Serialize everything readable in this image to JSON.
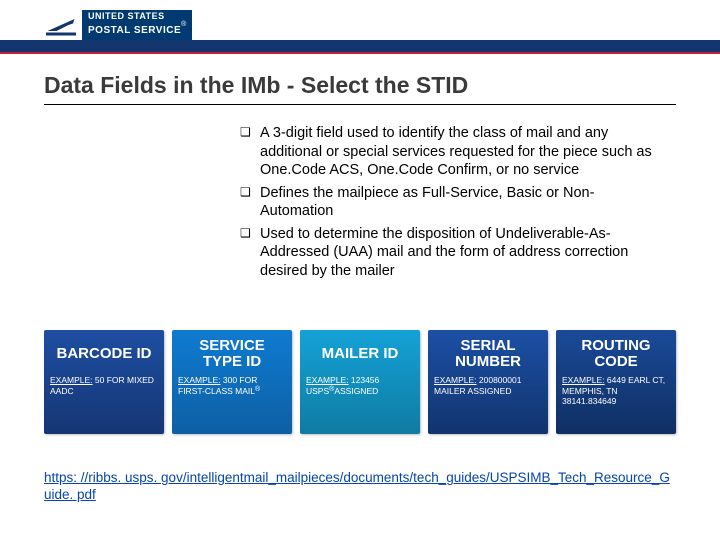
{
  "logo": {
    "line1": "UNITED STATES",
    "line2": "POSTAL SERVICE",
    "reg": "®"
  },
  "title": "Data Fields in the IMb - Select the STID",
  "bullets": [
    "A 3-digit field used to identify the class of mail and any additional or special services requested for the piece such as One.Code ACS, One.Code Confirm, or no service",
    "Defines the mailpiece as Full-Service, Basic or Non-Automation",
    "Used to determine the disposition of Undeliverable-As-Addressed (UAA) mail and the form of address correction desired by the mailer"
  ],
  "cards": [
    {
      "title": "BARCODE ID",
      "ex_label": "EXAMPLE:",
      "ex_text": " 50 FOR MIXED AADC",
      "color": "c-blue1"
    },
    {
      "title": "SERVICE TYPE ID",
      "ex_label": "EXAMPLE:",
      "ex_text": " 300 FOR FIRST-CLASS MAIL",
      "reg": "®",
      "color": "c-blue2"
    },
    {
      "title": "MAILER ID",
      "ex_label": "EXAMPLE:",
      "ex_text": " 123456",
      "reg_after": "®",
      "extra": "USPS",
      "extra2": "ASSIGNED",
      "color": "c-cyan"
    },
    {
      "title": "SERIAL NUMBER",
      "ex_label": "EXAMPLE:",
      "ex_text": " 200800001 MAILER ASSIGNED",
      "color": "c-blue3"
    },
    {
      "title": "ROUTING CODE",
      "ex_label": "EXAMPLE:",
      "ex_text": " 6449 EARL CT, MEMPHIS, TN 38141.834649",
      "color": "c-blue4"
    }
  ],
  "footer": {
    "url_text": "https: //ribbs. usps. gov/intelligentmail_mailpieces/documents/tech_guides/USPSIMB_Tech_Resource_Guide. pdf",
    "href": "https://ribbs.usps.gov/intelligentmail_mailpieces/documents/tech_guides/USPSIMB_Tech_Resource_Guide.pdf"
  }
}
